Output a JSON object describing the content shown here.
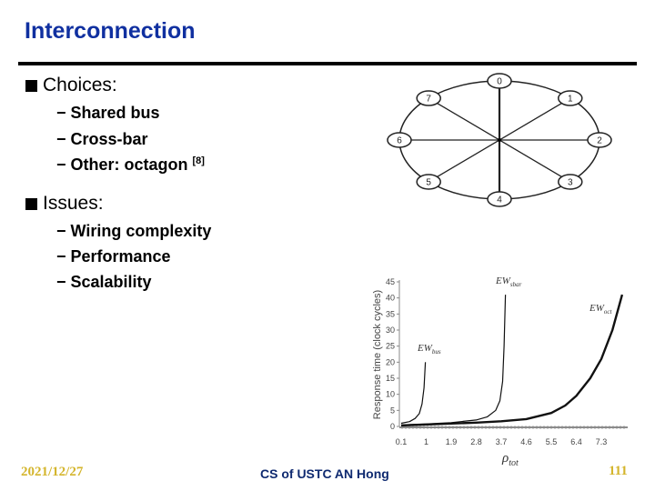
{
  "slide": {
    "title": "Interconnection",
    "sections": [
      {
        "label": "Choices:",
        "items": [
          {
            "text": "Shared bus",
            "sup": ""
          },
          {
            "text": "Cross-bar",
            "sup": ""
          },
          {
            "text": "Other: octagon ",
            "sup": "[8]"
          }
        ]
      },
      {
        "label": "Issues:",
        "items": [
          {
            "text": "Wiring complexity",
            "sup": ""
          },
          {
            "text": "Performance",
            "sup": ""
          },
          {
            "text": "Scalability",
            "sup": ""
          }
        ]
      }
    ],
    "dash": "−"
  },
  "octagon": {
    "nodes": [
      "0",
      "1",
      "2",
      "3",
      "4",
      "5",
      "6",
      "7"
    ]
  },
  "chart_data": {
    "type": "line",
    "title": "",
    "xlabel": "ρ_tot",
    "ylabel": "Response time (clock cycles)",
    "xticks": [
      "0.1",
      "1",
      "1.9",
      "2.8",
      "3.7",
      "4.6",
      "5.5",
      "6.4",
      "7.3"
    ],
    "yticks": [
      "0",
      "5",
      "10",
      "15",
      "20",
      "25",
      "30",
      "35",
      "40",
      "45"
    ],
    "xlim": [
      0.1,
      7.3
    ],
    "ylim": [
      0,
      45
    ],
    "series": [
      {
        "name": "EW_bus",
        "label_main": "EW",
        "label_sub": "bus",
        "x": [
          0.1,
          0.4,
          0.6,
          0.75,
          0.85,
          0.92,
          0.97
        ],
        "y": [
          1,
          1.5,
          2.5,
          4,
          7,
          12,
          20
        ]
      },
      {
        "name": "EW_sbar",
        "label_main": "EW",
        "label_sub": "sbar",
        "x": [
          0.1,
          1.0,
          1.9,
          2.8,
          3.2,
          3.5,
          3.65,
          3.75,
          3.8,
          3.85
        ],
        "y": [
          0.5,
          0.8,
          1.2,
          2,
          3,
          5,
          8,
          14,
          25,
          41
        ]
      },
      {
        "name": "EW_oct",
        "label_main": "EW",
        "label_sub": "oct",
        "x": [
          0.1,
          1.0,
          1.9,
          2.8,
          3.7,
          4.6,
          5.5,
          6.0,
          6.4,
          6.9,
          7.3,
          7.7,
          8.05
        ],
        "y": [
          0.3,
          0.6,
          0.9,
          1.2,
          1.6,
          2.3,
          4.2,
          6.5,
          9.5,
          15,
          21,
          30,
          41
        ]
      }
    ]
  },
  "footer": {
    "date": "2021/12/27",
    "center": "CS of USTC AN Hong",
    "page": "111"
  }
}
